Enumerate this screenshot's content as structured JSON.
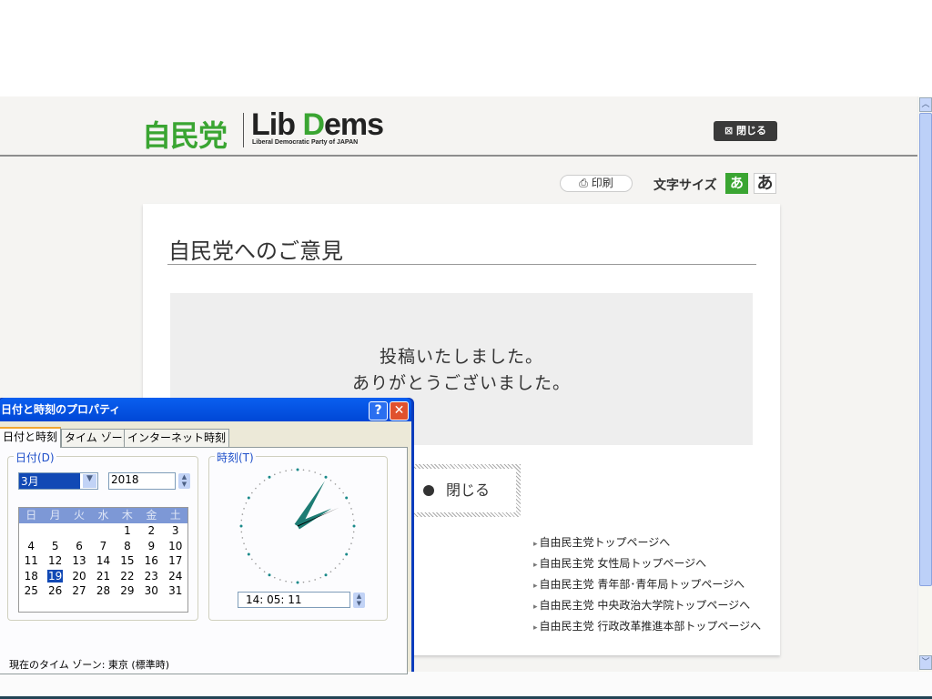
{
  "header": {
    "logo_jp": "自民党",
    "logo_en_a": "Lib ",
    "logo_en_b": "D",
    "logo_en_c": "ems",
    "logo_sub": "Liberal Democratic Party of JAPAN",
    "close_label": "⊠ 閉じる"
  },
  "tools": {
    "print_label": "印刷",
    "font_size_label": "文字サイズ",
    "font_small": "あ",
    "font_large": "あ"
  },
  "main": {
    "title": "自民党へのご意見",
    "message_line1": "投稿いたしました。",
    "message_line2": "ありがとうございました。",
    "close_button": "閉じる",
    "links": [
      "自由民主党トップページへ",
      "自由民主党 女性局トップページへ",
      "自由民主党 青年部･青年局トップページへ",
      "自由民主党 中央政治大学院トップページへ",
      "自由民主党 行政改革推進本部トップページへ"
    ]
  },
  "dialog": {
    "title": "日付と時刻のプロパティ",
    "tabs": [
      "日付と時刻",
      "タイム ゾーン",
      "インターネット時刻"
    ],
    "date_group": "日付(D)",
    "month": "3月",
    "year": "2018",
    "weekdays": [
      "日",
      "月",
      "火",
      "水",
      "木",
      "金",
      "土"
    ],
    "weeks": [
      [
        "",
        "",
        "",
        "",
        "1",
        "2",
        "3"
      ],
      [
        "4",
        "5",
        "6",
        "7",
        "8",
        "9",
        "10"
      ],
      [
        "11",
        "12",
        "13",
        "14",
        "15",
        "16",
        "17"
      ],
      [
        "18",
        "19",
        "20",
        "21",
        "22",
        "23",
        "24"
      ],
      [
        "25",
        "26",
        "27",
        "28",
        "29",
        "30",
        "31"
      ]
    ],
    "selected_day": "19",
    "time_group": "時刻(T)",
    "time": "14:  05:  11",
    "hour": 14,
    "minute": 5,
    "second": 11,
    "timezone": "現在のタイム ゾーン:  東京 (標準時)"
  },
  "colors": {
    "brand_green": "#3aa532",
    "xp_blue": "#0a3cbd"
  }
}
